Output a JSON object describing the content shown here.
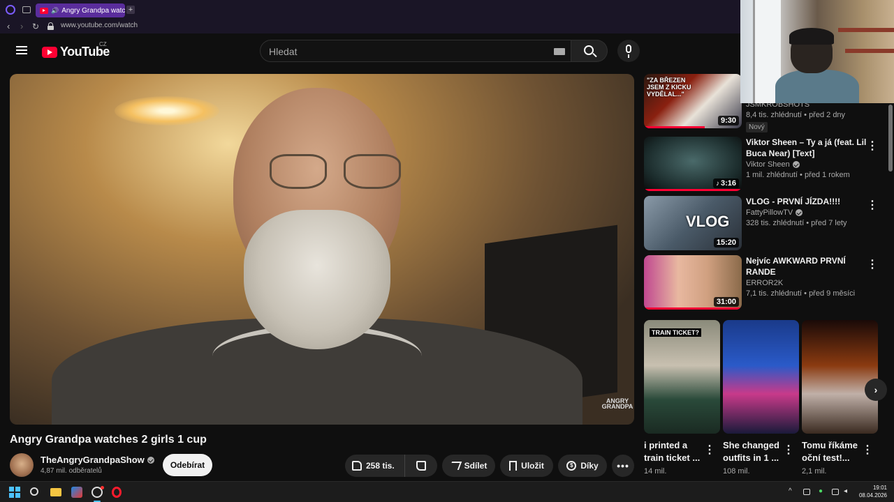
{
  "browser": {
    "tab_title": "Angry Grandpa watche",
    "new_tab": "+",
    "url": "www.youtube.com/watch"
  },
  "youtube": {
    "logo_text": "YouTube",
    "country": "CZ",
    "search_placeholder": "Hledat"
  },
  "video": {
    "watermark": "ANGRY GRANDPA",
    "title": "Angry Grandpa watches 2 girls 1 cup",
    "channel": "TheAngryGrandpaShow",
    "subscribers": "4,87 mil. odběratelů",
    "subscribe_label": "Odebírat",
    "likes": "258 tis.",
    "share_label": "Sdílet",
    "save_label": "Uložit",
    "thanks_label": "Díky",
    "more_label": "•••"
  },
  "recommendations": [
    {
      "title": "",
      "channel": "JSMKROBSHOTS",
      "meta": "8,4 tis. zhlédnutí • před 2 dny",
      "badge": "Nový",
      "duration": "9:30",
      "thumb_text": "\"ZA BŘEZEN JSEM Z KICKU VYDĚLAL...\"",
      "progress": 0.62
    },
    {
      "title": "Viktor Sheen – Ty a já (feat. Lil Buca Near) [Text]",
      "channel": "Viktor Sheen",
      "meta": "1 mil. zhlédnutí • před 1 rokem",
      "duration": "3:16",
      "progress": 1.0
    },
    {
      "title": "VLOG - PRVNÍ JÍZDA!!!!",
      "channel": "FattyPillowTV",
      "meta": "328 tis. zhlédnutí • před 7 lety",
      "duration": "15:20",
      "thumb_text": "VLOG",
      "progress": 0.0
    },
    {
      "title": "Nejvíc AWKWARD PRVNÍ RANDE",
      "channel": "ERROR2K",
      "meta": "7,1 tis. zhlédnutí • před 9 měsíci",
      "duration": "31:00",
      "progress": 1.0
    }
  ],
  "shorts": [
    {
      "title": "i printed a train ticket ...",
      "views": "14 mil.",
      "thumb_text": "TRAIN TICKET?"
    },
    {
      "title": "She changed outfits in 1 ...",
      "views": "108 mil."
    },
    {
      "title": "Tomu říkáme oční test!...",
      "views": "2,1 mil."
    }
  ],
  "taskbar": {
    "time": "19:01",
    "date": "08.04.2026"
  },
  "colors": {
    "accent_red": "#ff0033",
    "background": "#0f0f0f",
    "pill": "#272727",
    "active_tab": "#5a2d9c"
  }
}
